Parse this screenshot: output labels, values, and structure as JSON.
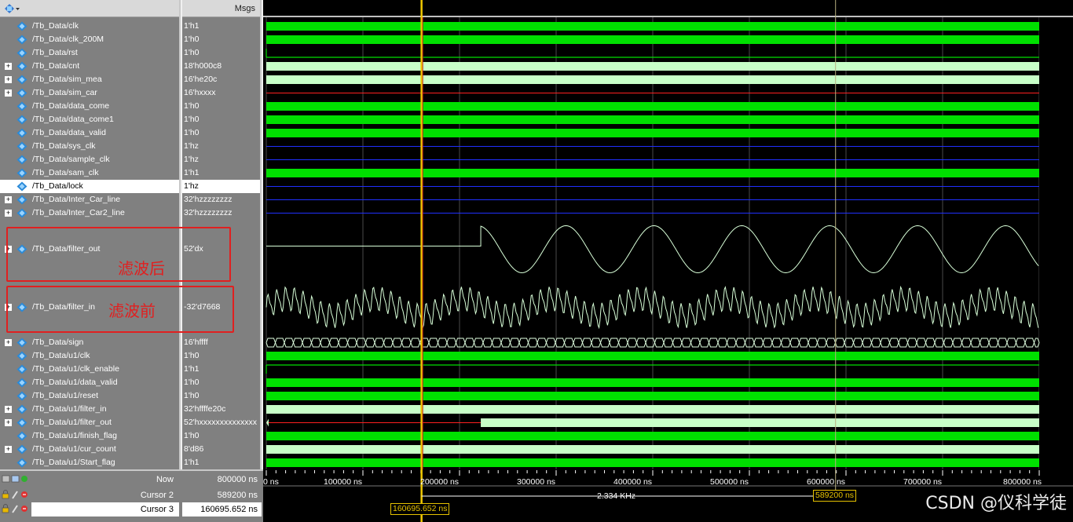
{
  "header": {
    "msgs_label": "Msgs"
  },
  "signals": [
    {
      "name": "/Tb_Data/clk",
      "value": "1'h1",
      "expand": false,
      "kind": "bit"
    },
    {
      "name": "/Tb_Data/clk_200M",
      "value": "1'h0",
      "expand": false,
      "kind": "bit"
    },
    {
      "name": "/Tb_Data/rst",
      "value": "1'h0",
      "expand": false,
      "kind": "bit"
    },
    {
      "name": "/Tb_Data/cnt",
      "value": "18'h000c8",
      "expand": true,
      "kind": "bus"
    },
    {
      "name": "/Tb_Data/sim_mea",
      "value": "16'he20c",
      "expand": true,
      "kind": "bus"
    },
    {
      "name": "/Tb_Data/sim_car",
      "value": "16'hxxxx",
      "expand": true,
      "kind": "bus"
    },
    {
      "name": "/Tb_Data/data_come",
      "value": "1'h0",
      "expand": false,
      "kind": "bit"
    },
    {
      "name": "/Tb_Data/data_come1",
      "value": "1'h0",
      "expand": false,
      "kind": "bit"
    },
    {
      "name": "/Tb_Data/data_valid",
      "value": "1'h0",
      "expand": false,
      "kind": "bit"
    },
    {
      "name": "/Tb_Data/sys_clk",
      "value": "1'hz",
      "expand": false,
      "kind": "bit"
    },
    {
      "name": "/Tb_Data/sample_clk",
      "value": "1'hz",
      "expand": false,
      "kind": "bit"
    },
    {
      "name": "/Tb_Data/sam_clk",
      "value": "1'h1",
      "expand": false,
      "kind": "bit"
    },
    {
      "name": "/Tb_Data/lock",
      "value": "1'hz",
      "expand": false,
      "kind": "bit",
      "selected": true
    },
    {
      "name": "/Tb_Data/Inter_Car_line",
      "value": "32'hzzzzzzzz",
      "expand": true,
      "kind": "bus"
    },
    {
      "name": "/Tb_Data/Inter_Car2_line",
      "value": "32'hzzzzzzzz",
      "expand": true,
      "kind": "bus"
    },
    {
      "name": "/Tb_Data/filter_out",
      "value": "52'dx",
      "expand": true,
      "kind": "analog"
    },
    {
      "name": "/Tb_Data/filter_in",
      "value": "-32'd7668",
      "expand": true,
      "kind": "analog"
    },
    {
      "name": "/Tb_Data/sign",
      "value": "16'hffff",
      "expand": true,
      "kind": "bus"
    },
    {
      "name": "/Tb_Data/u1/clk",
      "value": "1'h0",
      "expand": false,
      "kind": "bit"
    },
    {
      "name": "/Tb_Data/u1/clk_enable",
      "value": "1'h1",
      "expand": false,
      "kind": "bit"
    },
    {
      "name": "/Tb_Data/u1/data_valid",
      "value": "1'h0",
      "expand": false,
      "kind": "bit"
    },
    {
      "name": "/Tb_Data/u1/reset",
      "value": "1'h0",
      "expand": false,
      "kind": "bit"
    },
    {
      "name": "/Tb_Data/u1/filter_in",
      "value": "32'hffffe20c",
      "expand": true,
      "kind": "bus"
    },
    {
      "name": "/Tb_Data/u1/filter_out",
      "value": "52'hxxxxxxxxxxxxxx",
      "expand": true,
      "kind": "bus"
    },
    {
      "name": "/Tb_Data/u1/finish_flag",
      "value": "1'h0",
      "expand": false,
      "kind": "bit"
    },
    {
      "name": "/Tb_Data/u1/cur_count",
      "value": "8'd86",
      "expand": true,
      "kind": "bus"
    },
    {
      "name": "/Tb_Data/u1/Start_flag",
      "value": "1'h1",
      "expand": false,
      "kind": "bit"
    }
  ],
  "annotations": {
    "after": "滤波后",
    "before": "滤波前"
  },
  "bottom": {
    "now_label": "Now",
    "now_value": "800000 ns",
    "cursor2_label": "Cursor 2",
    "cursor2_value": "589200 ns",
    "cursor3_label": "Cursor 3",
    "cursor3_value": "160695.652 ns"
  },
  "timeline": {
    "ticks": [
      "0 ns",
      "100000 ns",
      "200000 ns",
      "300000 ns",
      "400000 ns",
      "500000 ns",
      "600000 ns",
      "700000 ns",
      "800000 ns"
    ],
    "freq_label": "2.334 KHz",
    "cursor3_tag": "160695.652 ns",
    "cursor2_tag": "589200 ns",
    "range_ns": [
      0,
      800000
    ],
    "cursor3_ns": 160695.652,
    "cursor2_ns": 589200
  },
  "watermark": "CSDN @仪科学徒",
  "colors": {
    "bit_green": "#00e000",
    "bus_light": "#c8ffc8",
    "z_blue": "#2030ff",
    "x_red": "#ff2020",
    "cursor_yellow": "#f0c800",
    "analog": "#d8ffd8"
  }
}
